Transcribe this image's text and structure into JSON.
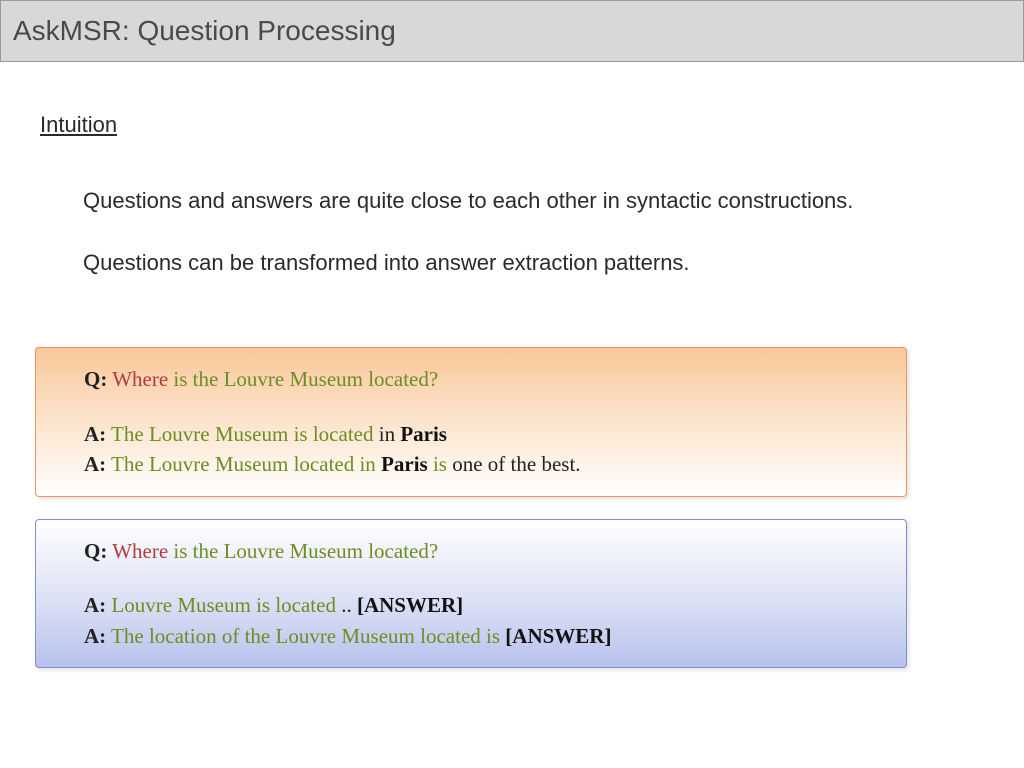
{
  "header": {
    "title": "AskMSR: Question Processing"
  },
  "section": {
    "label": "Intuition",
    "line1": "Questions and answers are quite close to each other in syntactic constructions.",
    "line2": "Questions can be transformed into answer extraction patterns."
  },
  "box1": {
    "q_prefix": "Q:",
    "q_where": "Where",
    "q_rest": "is the Louvre Museum located?",
    "a1_prefix": "A:",
    "a1_olive": "The Louvre Museum is located",
    "a1_in": "in",
    "a1_bold": "Paris",
    "a2_prefix": "A:",
    "a2_olive1": "The Louvre Museum located in",
    "a2_bold": "Paris",
    "a2_olive2": "is",
    "a2_rest": "one of the best."
  },
  "box2": {
    "q_prefix": "Q:",
    "q_where": "Where",
    "q_rest": "is the Louvre Museum located?",
    "a1_prefix": "A:",
    "a1_olive": "Louvre Museum is located",
    "a1_dots": "..",
    "a1_answer": "[ANSWER]",
    "a2_prefix": "A:",
    "a2_olive": "The location of the Louvre Museum located is",
    "a2_answer": "[ANSWER]"
  }
}
